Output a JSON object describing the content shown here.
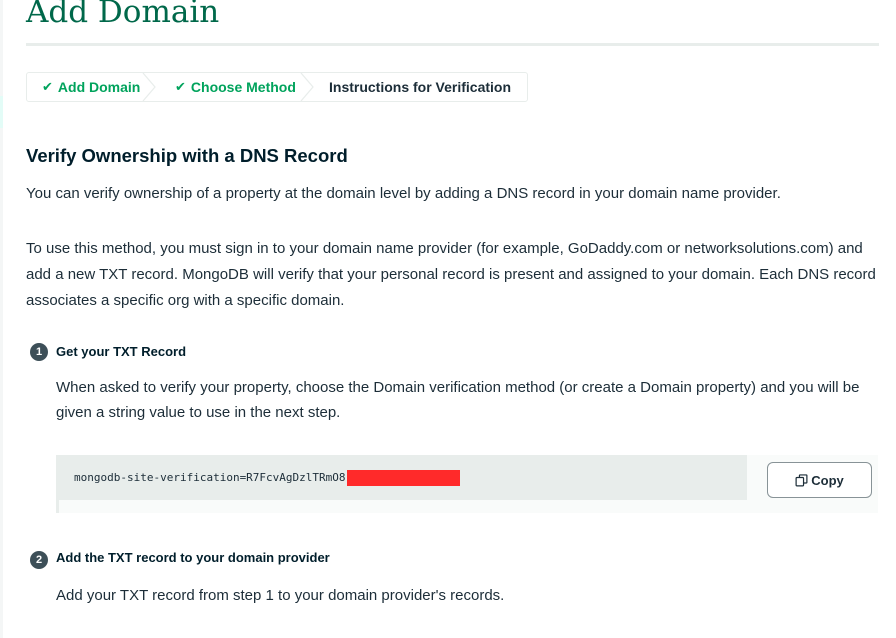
{
  "page": {
    "title": "Add Domain"
  },
  "breadcrumb": {
    "steps": [
      {
        "label": "Add Domain",
        "status": "complete",
        "icon": "check-icon"
      },
      {
        "label": "Choose Method",
        "status": "complete",
        "icon": "check-icon"
      },
      {
        "label": "Instructions for Verification",
        "status": "current"
      }
    ],
    "check_glyph": "✔"
  },
  "content": {
    "heading": "Verify Ownership with a DNS Record",
    "intro": "You can verify ownership of a property at the domain level by adding a DNS record in your domain name provider.",
    "details": "To use this method, you must sign in to your domain name provider (for example, GoDaddy.com or networksolutions.com) and add a new TXT record. MongoDB will verify that your personal record is present and assigned to your domain. Each DNS record associates a specific org with a specific domain."
  },
  "steps": [
    {
      "number": "1",
      "title": "Get your TXT Record",
      "text": "When asked to verify your property, choose the Domain verification method (or create a Domain property) and you will be given a string value to use in the next step."
    },
    {
      "number": "2",
      "title": "Add the TXT record to your domain provider",
      "text": "Add your TXT record from step 1 to your domain provider's records."
    }
  ],
  "txt_record": {
    "value": "mongodb-site-verification=R7FcvAgDzlTRmO8",
    "redacted": true,
    "copy_label": "Copy",
    "copy_icon": "copy-icon"
  },
  "colors": {
    "title": "#00684a",
    "complete_step": "#00a35c",
    "text": "#1c2d38",
    "redaction": "#ff2a2a",
    "badge": "#3d4f58"
  }
}
